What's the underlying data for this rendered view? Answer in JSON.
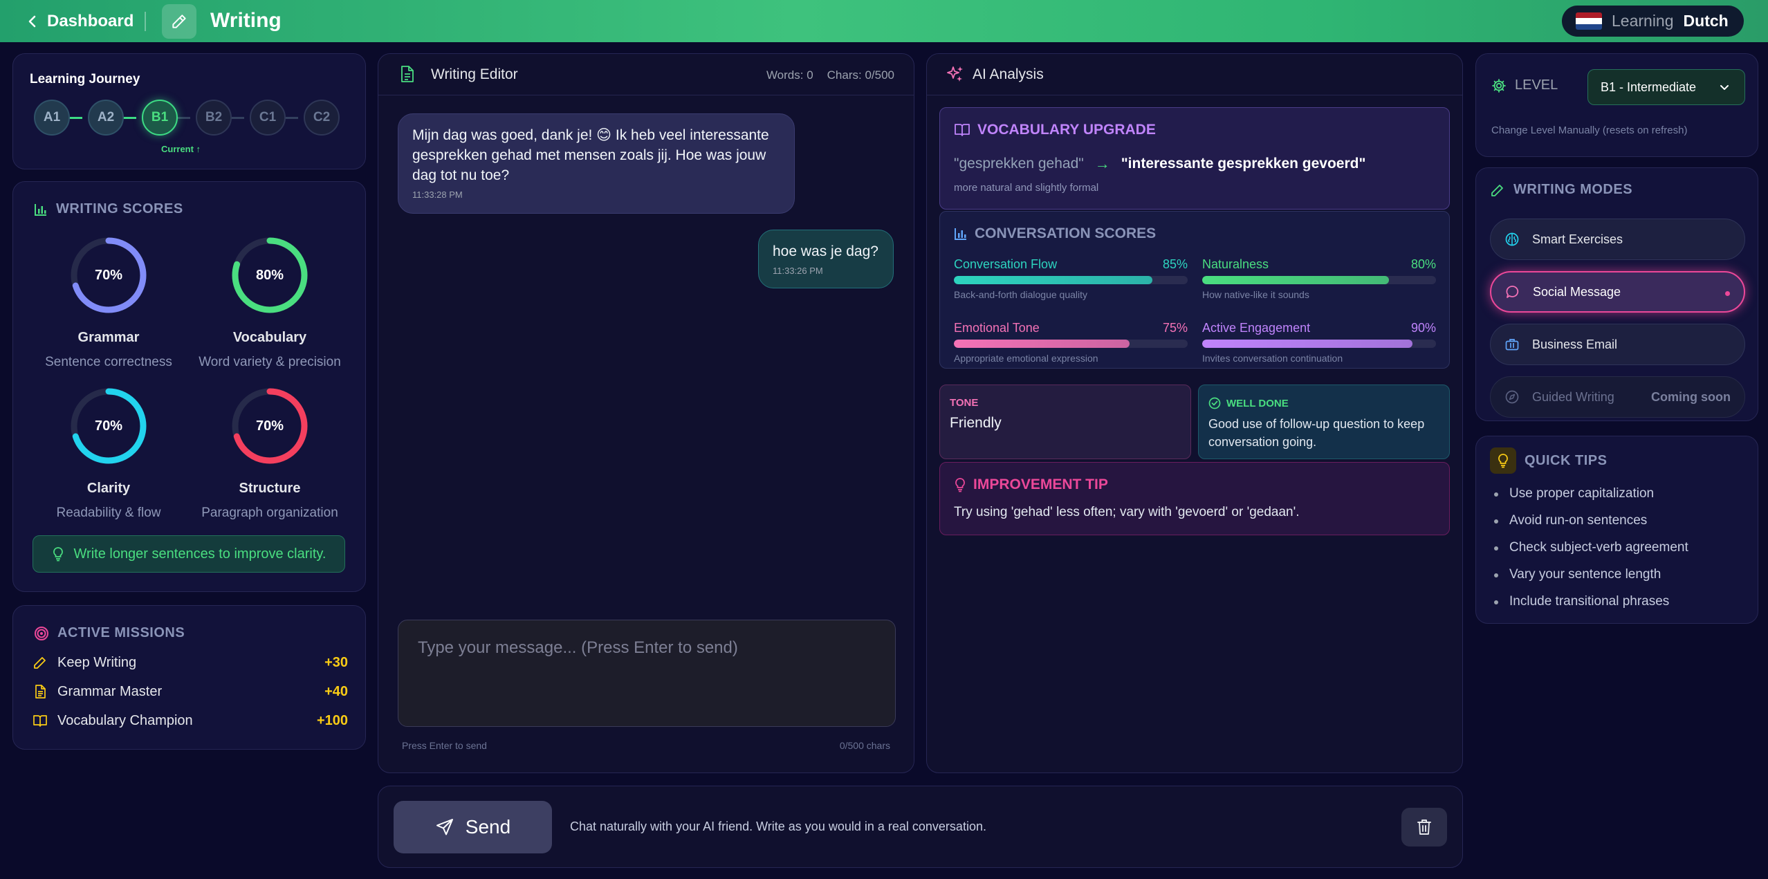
{
  "header": {
    "back_label": "Dashboard",
    "title": "Writing",
    "learning_label": "Learning",
    "language": "Dutch",
    "flag_colors": [
      "#ae1c28",
      "#ffffff",
      "#21468b"
    ],
    "gradient_accent": "#3ec27d"
  },
  "journey": {
    "title": "Learning Journey",
    "levels": [
      "A1",
      "A2",
      "B1",
      "B2",
      "C1",
      "C2"
    ],
    "current_level": "B1",
    "current_label": "Current ↑"
  },
  "scores": {
    "title": "WRITING SCORES",
    "items": [
      {
        "name": "Grammar",
        "desc": "Sentence correctness",
        "value": "70%",
        "percent": 70,
        "color": "#818cf8"
      },
      {
        "name": "Vocabulary",
        "desc": "Word variety & precision",
        "value": "80%",
        "percent": 80,
        "color": "#4ade80"
      },
      {
        "name": "Clarity",
        "desc": "Readability & flow",
        "value": "70%",
        "percent": 70,
        "color": "#22d3ee"
      },
      {
        "name": "Structure",
        "desc": "Paragraph organization",
        "value": "70%",
        "percent": 70,
        "color": "#f43f5e"
      }
    ],
    "tip": "Write longer sentences to improve clarity."
  },
  "missions": {
    "title": "ACTIVE MISSIONS",
    "items": [
      {
        "label": "Keep Writing",
        "points": "+30",
        "icon": "pencil-icon"
      },
      {
        "label": "Grammar Master",
        "points": "+40",
        "icon": "document-icon"
      },
      {
        "label": "Vocabulary Champion",
        "points": "+100",
        "icon": "book-icon"
      }
    ]
  },
  "editor": {
    "title": "Writing Editor",
    "words": "Words: 0",
    "chars": "Chars: 0/500",
    "messages": [
      {
        "role": "ai",
        "text": "Mijn dag was goed, dank je! 😊 Ik heb veel interessante gesprekken gehad met mensen zoals jij. Hoe was jouw dag tot nu toe?",
        "time": "11:33:28 PM"
      },
      {
        "role": "user",
        "text": "hoe was je dag?",
        "time": "11:33:26 PM"
      }
    ],
    "input_placeholder": "Type your message... (Press Enter to send)",
    "hint_left": "Press Enter to send",
    "hint_right": "0/500 chars"
  },
  "analysis": {
    "title": "AI Analysis",
    "vocab": {
      "title": "VOCABULARY UPGRADE",
      "old": "\"gesprekken gehad\"",
      "arrow": "→",
      "new": "\"interessante gesprekken gevoerd\"",
      "note": "more natural and slightly formal"
    },
    "conversation": {
      "title": "CONVERSATION SCORES",
      "metrics": [
        {
          "name": "Conversation Flow",
          "value": "85%",
          "percent": 85,
          "desc": "Back-and-forth dialogue quality",
          "color": "#2dd4bf"
        },
        {
          "name": "Naturalness",
          "value": "80%",
          "percent": 80,
          "desc": "How native-like it sounds",
          "color": "#4ade80"
        },
        {
          "name": "Emotional Tone",
          "value": "75%",
          "percent": 75,
          "desc": "Appropriate emotional expression",
          "color": "#f472b6"
        },
        {
          "name": "Active Engagement",
          "value": "90%",
          "percent": 90,
          "desc": "Invites conversation continuation",
          "color": "#c084fc"
        }
      ]
    },
    "tone": {
      "label": "TONE",
      "value": "Friendly"
    },
    "well_done": {
      "label": "WELL DONE",
      "text": "Good use of follow-up question to keep conversation going."
    },
    "improvement": {
      "title": "IMPROVEMENT TIP",
      "text": "Try using 'gehad' less often; vary with 'gevoerd' or 'gedaan'."
    }
  },
  "level_panel": {
    "label": "LEVEL",
    "selected": "B1 - Intermediate",
    "note": "Change Level Manually (resets on refresh)"
  },
  "modes": {
    "title": "WRITING MODES",
    "items": [
      {
        "label": "Smart Exercises",
        "icon": "brain-icon",
        "state": "normal"
      },
      {
        "label": "Social Message",
        "icon": "chat-bubble-icon",
        "state": "active"
      },
      {
        "label": "Business Email",
        "icon": "briefcase-icon",
        "state": "normal"
      },
      {
        "label": "Guided Writing",
        "icon": "compass-icon",
        "state": "disabled",
        "badge": "Coming soon"
      }
    ]
  },
  "tips": {
    "title": "QUICK TIPS",
    "items": [
      "Use proper capitalization",
      "Avoid run-on sentences",
      "Check subject-verb agreement",
      "Vary your sentence length",
      "Include transitional phrases"
    ]
  },
  "actions": {
    "send_label": "Send",
    "hint": "Chat naturally with your AI friend. Write as you would in a real conversation."
  }
}
